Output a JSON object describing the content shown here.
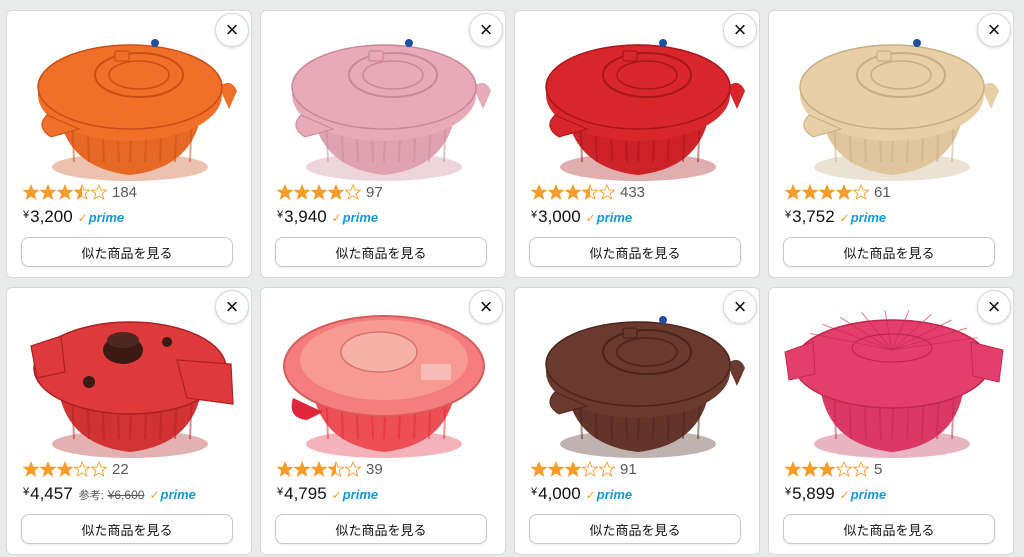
{
  "products": [
    {
      "rating": 3.5,
      "review_count": "184",
      "currency": "¥",
      "price": "3,200",
      "ref_label": "",
      "ref_price": "",
      "prime": "prime",
      "button_label": "似た商品を見る",
      "color": "#f0702a",
      "dark": "#c84e13",
      "lid_style": "dome"
    },
    {
      "rating": 4.0,
      "review_count": "97",
      "currency": "¥",
      "price": "3,940",
      "ref_label": "",
      "ref_price": "",
      "prime": "prime",
      "button_label": "似た商品を見る",
      "color": "#e9aab8",
      "dark": "#c98897",
      "lid_style": "dome"
    },
    {
      "rating": 3.5,
      "review_count": "433",
      "currency": "¥",
      "price": "3,000",
      "ref_label": "",
      "ref_price": "",
      "prime": "prime",
      "button_label": "似た商品を見る",
      "color": "#d8262c",
      "dark": "#a6161b",
      "lid_style": "dome"
    },
    {
      "rating": 4.0,
      "review_count": "61",
      "currency": "¥",
      "price": "3,752",
      "ref_label": "",
      "ref_price": "",
      "prime": "prime",
      "button_label": "似た商品を見る",
      "color": "#e8cfa6",
      "dark": "#c6ad84",
      "lid_style": "dome"
    },
    {
      "rating": 3.0,
      "review_count": "22",
      "currency": "¥",
      "price": "4,457",
      "ref_label": "参考:",
      "ref_price": "¥6,600",
      "prime": "prime",
      "button_label": "似た商品を見る",
      "color": "#de3a3b",
      "dark": "#ad2021",
      "lid_style": "knob"
    },
    {
      "rating": 3.5,
      "review_count": "39",
      "currency": "¥",
      "price": "4,795",
      "ref_label": "",
      "ref_price": "",
      "prime": "prime",
      "button_label": "似た商品を見る",
      "color": "#f35d5d",
      "dark": "#e0263a",
      "lid_style": "flat"
    },
    {
      "rating": 3.0,
      "review_count": "91",
      "currency": "¥",
      "price": "4,000",
      "ref_label": "",
      "ref_price": "",
      "prime": "prime",
      "button_label": "似た商品を見る",
      "color": "#6b3a2e",
      "dark": "#4b241b",
      "lid_style": "dome"
    },
    {
      "rating": 3.0,
      "review_count": "5",
      "currency": "¥",
      "price": "5,899",
      "ref_label": "",
      "ref_price": "",
      "prime": "prime",
      "button_label": "似た商品を見る",
      "color": "#e43f6a",
      "dark": "#c12750",
      "lid_style": "wide"
    }
  ],
  "close_icon": "×",
  "star_colors": {
    "filled": "#f69c2a",
    "empty_stroke": "#f69c2a"
  }
}
